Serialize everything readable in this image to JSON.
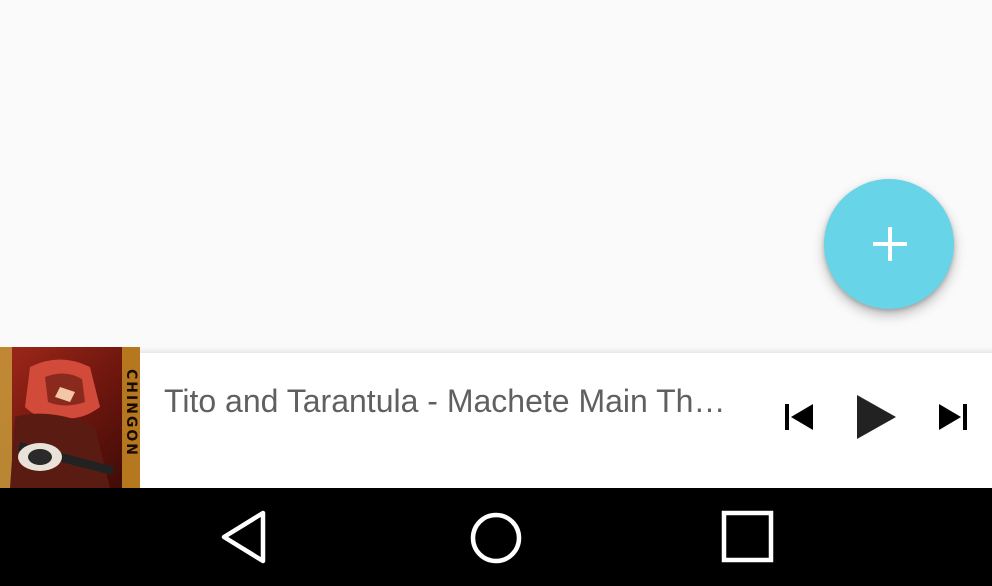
{
  "fab": {
    "icon": "plus-icon",
    "color": "#67d4e8"
  },
  "now_playing": {
    "title": "Tito and Tarantula - Machete Main Theme",
    "album_art_text": "CHINGON",
    "controls": {
      "previous_icon": "skip-previous-icon",
      "play_icon": "play-icon",
      "next_icon": "skip-next-icon"
    }
  },
  "navigation_bar": {
    "back_icon": "back-icon",
    "home_icon": "home-icon",
    "recents_icon": "recents-icon"
  }
}
